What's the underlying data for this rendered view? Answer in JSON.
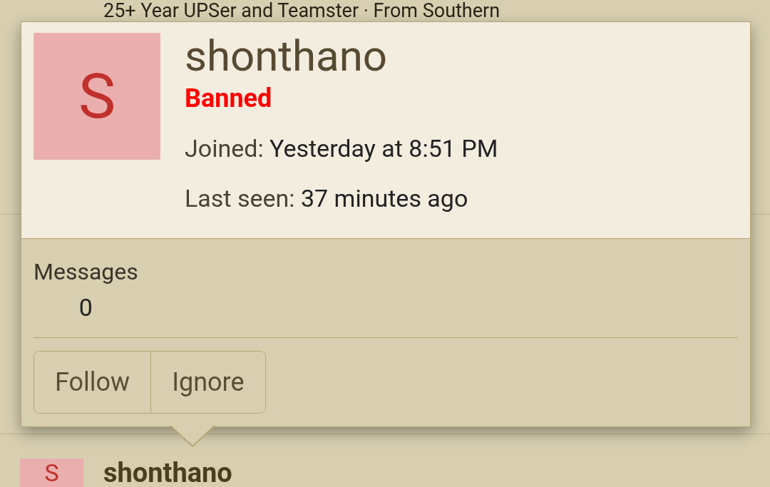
{
  "background": {
    "tagline": "25+ Year UPSer and Teamster · From Southern",
    "post_author": {
      "initial": "S",
      "name": "shonthano"
    }
  },
  "member_card": {
    "initial": "S",
    "username": "shonthano",
    "banner": "Banned",
    "joined": {
      "label": "Joined:",
      "value": "Yesterday at 8:51 PM"
    },
    "last_seen": {
      "label": "Last seen:",
      "value": "37 minutes ago"
    },
    "stats": [
      {
        "label": "Messages",
        "value": "0"
      }
    ],
    "buttons": [
      "Follow",
      "Ignore"
    ]
  }
}
